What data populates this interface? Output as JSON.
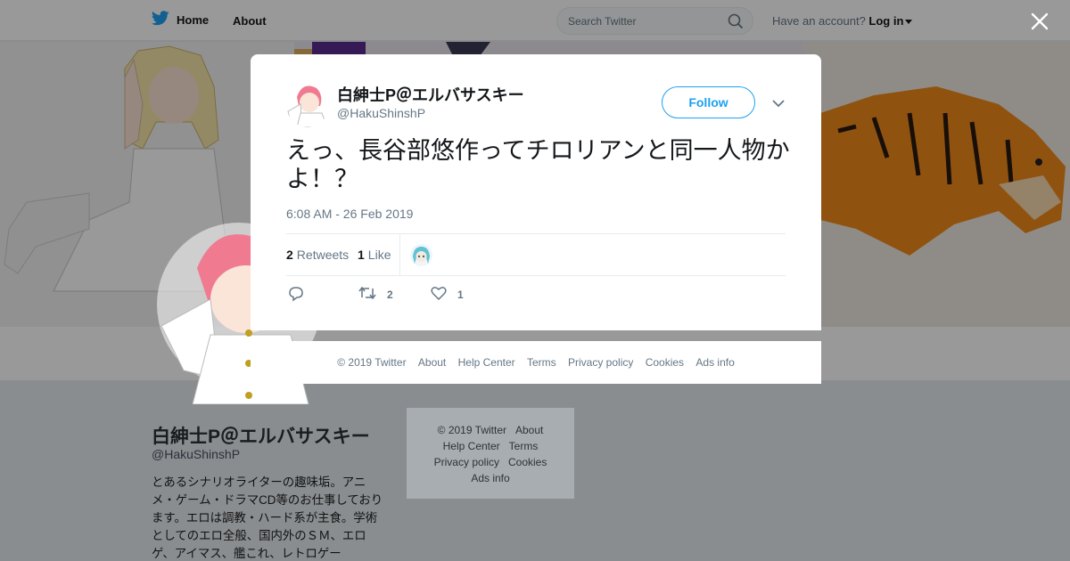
{
  "nav": {
    "home_label": "Home",
    "about_label": "About",
    "search_placeholder": "Search Twitter",
    "account_prompt": "Have an account?",
    "login_label": "Log in"
  },
  "tweet": {
    "author_name": "白紳士P＠エルバサスキー",
    "author_handle": "@HakuShinshP",
    "follow_label": "Follow",
    "text": "えっ、長谷部悠作ってチロリアンと同一人物かよ！？",
    "timestamp": "6:08 AM - 26 Feb 2019",
    "retweet_count": "2",
    "retweet_label": "Retweets",
    "like_count": "1",
    "like_label": "Like",
    "action_retweet_count": "2",
    "action_like_count": "1"
  },
  "modal_footer": {
    "copyright": "© 2019 Twitter",
    "about": "About",
    "help_center": "Help Center",
    "terms": "Terms",
    "privacy": "Privacy policy",
    "cookies": "Cookies",
    "ads_info": "Ads info"
  },
  "profile": {
    "name": "白紳士P＠エルバサスキー",
    "handle": "@HakuShinshP",
    "bio": "とあるシナリオライターの趣味垢。アニメ・ゲーム・ドラマCD等のお仕事しております。エロは調教・ハード系が主食。学術としてのエロ全般、国内外のＳＭ、エロゲ、アイマス、艦これ、レトロゲー"
  },
  "side_footer": {
    "copyright": "© 2019 Twitter",
    "about": "About",
    "help_center": "Help Center",
    "terms": "Terms",
    "privacy": "Privacy policy",
    "cookies": "Cookies",
    "ads_info": "Ads info"
  },
  "colors": {
    "accent": "#1da1f2",
    "overlay": "rgba(0,0,0,0.4)"
  }
}
